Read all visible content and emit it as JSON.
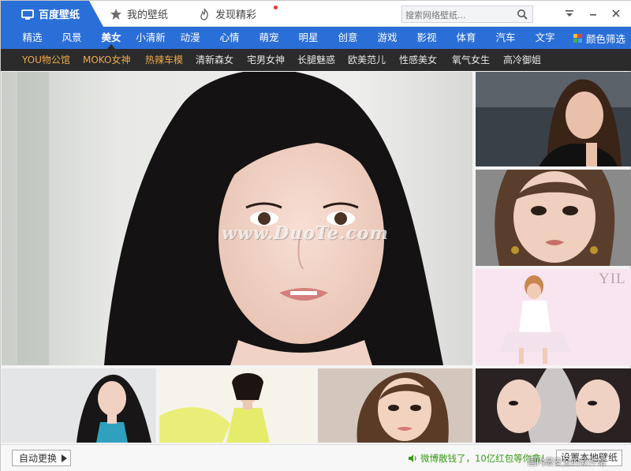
{
  "app": {
    "tabs": [
      {
        "label": "百度壁纸",
        "icon": "tv-icon",
        "active": true
      },
      {
        "label": "我的壁纸",
        "icon": "star-icon"
      },
      {
        "label": "发现精彩",
        "icon": "flame-icon",
        "badge": "red-dot"
      }
    ],
    "search": {
      "placeholder": "搜索网络壁纸..."
    },
    "window_buttons": [
      "menu-icon",
      "minimize-icon",
      "close-icon"
    ]
  },
  "categories": {
    "items": [
      "精选",
      "风景",
      "美女",
      "小清新",
      "动漫",
      "心情",
      "萌宠",
      "明星",
      "创意",
      "游戏",
      "影视",
      "体育",
      "汽车",
      "文字"
    ],
    "active": "美女",
    "color_filter": "颜色筛选"
  },
  "subcategories": {
    "items": [
      "YOU物公馆",
      "MOKO女神",
      "热辣车模",
      "清新森女",
      "宅男女神",
      "长腿魅惑",
      "欧美范儿",
      "性感美女",
      "氧气女生",
      "高冷御姐"
    ],
    "hot_count": 3
  },
  "gallery": {
    "watermark": "www.DuoTe.com",
    "tile_r3_text": "YIL"
  },
  "footer": {
    "auto_change": "自动更换",
    "promo": "微博散钱了，10亿红包等你拿！",
    "set_local": "设置本地壁纸",
    "site_text": "国内最安全的软件站"
  },
  "colors": {
    "accent_blue": "#2a6ed8",
    "subbar_dark": "#2b2b2b",
    "hot_orange": "#f0a94a",
    "promo_green": "#3a9a18"
  }
}
